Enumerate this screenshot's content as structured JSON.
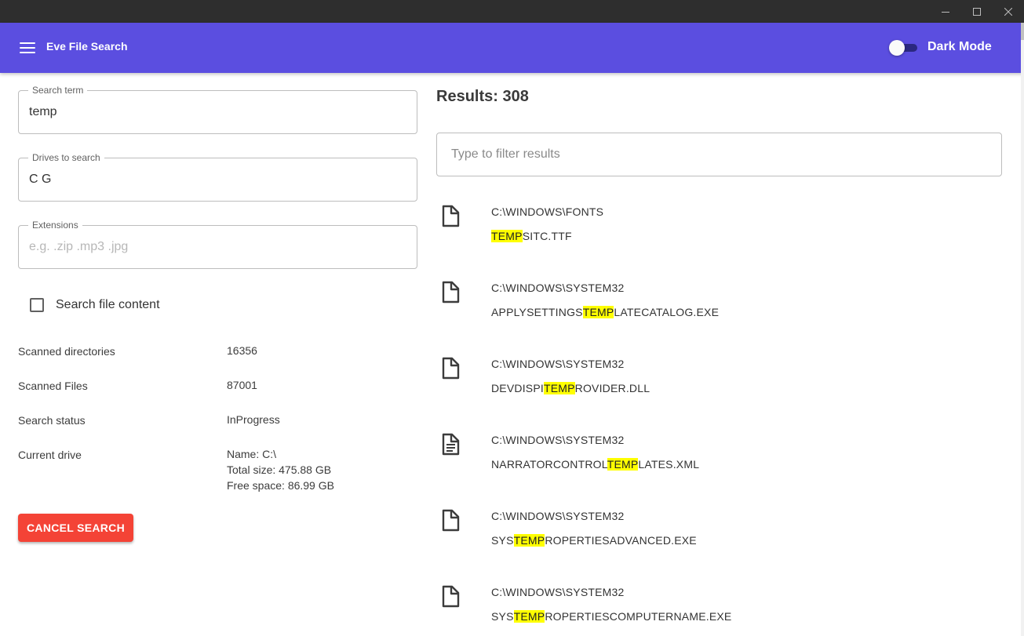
{
  "app": {
    "title": "Eve File Search",
    "dark_mode_label": "Dark Mode",
    "accent_color": "#5b4ee0"
  },
  "window_controls": [
    "minimize-icon",
    "maximize-icon",
    "close-icon"
  ],
  "form": {
    "search_term": {
      "label": "Search term",
      "value": "temp"
    },
    "drives": {
      "label": "Drives to search",
      "value": "C G"
    },
    "extensions": {
      "label": "Extensions",
      "value": "",
      "placeholder": "e.g. .zip .mp3 .jpg"
    },
    "search_content": {
      "label": "Search file content",
      "checked": false
    }
  },
  "stats": {
    "scanned_directories": {
      "label": "Scanned directories",
      "value": "16356"
    },
    "scanned_files": {
      "label": "Scanned Files",
      "value": "87001"
    },
    "search_status": {
      "label": "Search status",
      "value": "InProgress"
    },
    "current_drive": {
      "label": "Current drive",
      "name": "Name: C:\\",
      "total": "Total size: 475.88 GB",
      "free": "Free space: 86.99 GB"
    }
  },
  "cancel_label": "CANCEL SEARCH",
  "results": {
    "title": "Results: 308",
    "filter_placeholder": "Type to filter results",
    "highlight_color": "#ffff00",
    "items": [
      {
        "path": "C:\\WINDOWS\\FONTS",
        "pre": "",
        "match": "TEMP",
        "post": "SITC.TTF",
        "icon": "file-icon"
      },
      {
        "path": "C:\\WINDOWS\\SYSTEM32",
        "pre": "APPLYSETTINGS",
        "match": "TEMP",
        "post": "LATECATALOG.EXE",
        "icon": "file-icon"
      },
      {
        "path": "C:\\WINDOWS\\SYSTEM32",
        "pre": "DEVDISPI",
        "match": "TEMP",
        "post": "ROVIDER.DLL",
        "icon": "file-icon"
      },
      {
        "path": "C:\\WINDOWS\\SYSTEM32",
        "pre": "NARRATORCONTROL",
        "match": "TEMP",
        "post": "LATES.XML",
        "icon": "text-file-icon"
      },
      {
        "path": "C:\\WINDOWS\\SYSTEM32",
        "pre": "SYS",
        "match": "TEMP",
        "post": "ROPERTIESADVANCED.EXE",
        "icon": "file-icon"
      },
      {
        "path": "C:\\WINDOWS\\SYSTEM32",
        "pre": "SYS",
        "match": "TEMP",
        "post": "ROPERTIESCOMPUTERNAME.EXE",
        "icon": "file-icon"
      }
    ]
  }
}
